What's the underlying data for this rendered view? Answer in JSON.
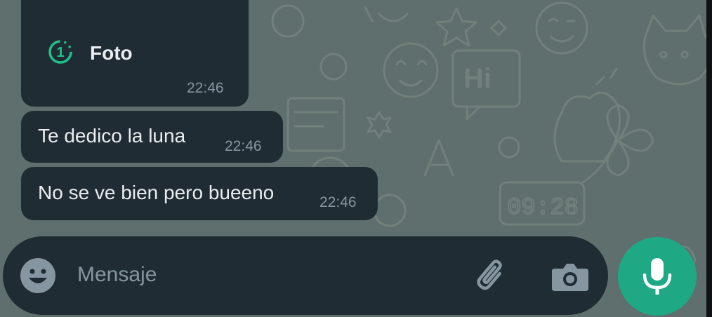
{
  "messages": [
    {
      "type": "photo",
      "label": "Foto",
      "icon": "view-once-icon",
      "time": "22:46"
    },
    {
      "type": "text",
      "text": "Te dedico la luna",
      "time": "22:46"
    },
    {
      "type": "text",
      "text": "No se ve bien pero bueeno",
      "time": "22:46"
    }
  ],
  "composer": {
    "placeholder": "Mensaje"
  },
  "icons": {
    "emoji": "emoji-icon",
    "attach": "paperclip-icon",
    "camera": "camera-icon",
    "mic": "mic-icon"
  },
  "colors": {
    "bubble": "#1f2c33",
    "accent": "#1fa884",
    "wallpaper": "#5f6f6d",
    "timestamp": "#8696a0"
  }
}
